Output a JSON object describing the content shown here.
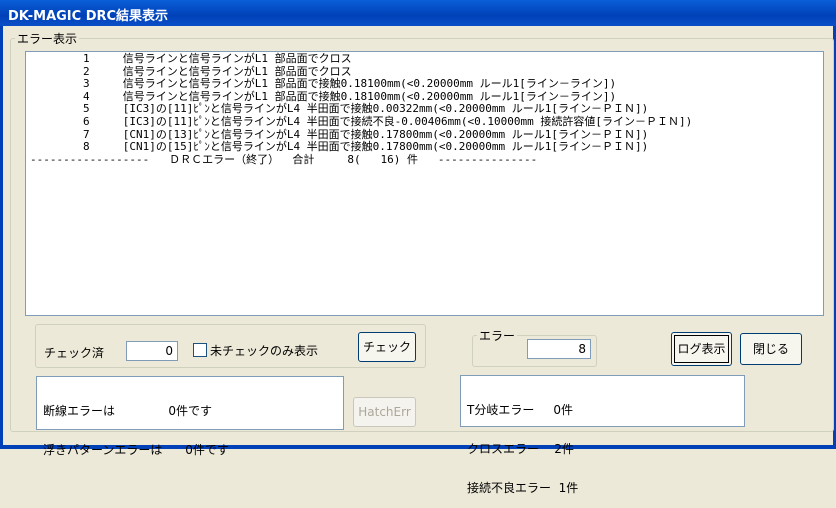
{
  "window": {
    "title": "DK-MAGIC DRC結果表示"
  },
  "errors_group": {
    "legend": "エラー表示",
    "lines": [
      "        1     信号ラインと信号ラインがL1 部品面でクロス",
      "        2     信号ラインと信号ラインがL1 部品面でクロス",
      "        3     信号ラインと信号ラインがL1 部品面で接触0.18100mm(<0.20000mm ルール1[ライン－ライン])",
      "        4     信号ラインと信号ラインがL1 部品面で接触0.18100mm(<0.20000mm ルール1[ライン－ライン])",
      "        5     [IC3]の[11]ﾋﾟﾝと信号ラインがL4 半田面で接触0.00322mm(<0.20000mm ルール1[ライン－ＰＩＮ])",
      "        6     [IC3]の[11]ﾋﾟﾝと信号ラインがL4 半田面で接続不良-0.00406mm(<0.10000mm 接続許容値[ライン－ＰＩＮ])",
      "        7     [CN1]の[13]ﾋﾟﾝと信号ラインがL4 半田面で接触0.17800mm(<0.20000mm ルール1[ライン－ＰＩＮ])",
      "        8     [CN1]の[15]ﾋﾟﾝと信号ラインがL4 半田面で接触0.17800mm(<0.20000mm ルール1[ライン－ＰＩＮ])",
      "------------------   ＤＲＣエラー（終了）  合計     8(   16) 件   ---------------"
    ]
  },
  "check": {
    "checked_label": "チェック済",
    "checked_value": "0",
    "unchecked_only_label": "未チェックのみ表示",
    "check_button": "チェック"
  },
  "error_count": {
    "legend": "エラー",
    "value": "8"
  },
  "buttons": {
    "log": "ログ表示",
    "close": "閉じる",
    "hatch": "HatchErr"
  },
  "left_summary": [
    "断線エラーは              0件です",
    "浮きパターンエラーは      0件です"
  ],
  "right_summary": [
    "T分岐エラー     0件",
    "クロスエラー    2件",
    "接続不良エラー  1件"
  ]
}
